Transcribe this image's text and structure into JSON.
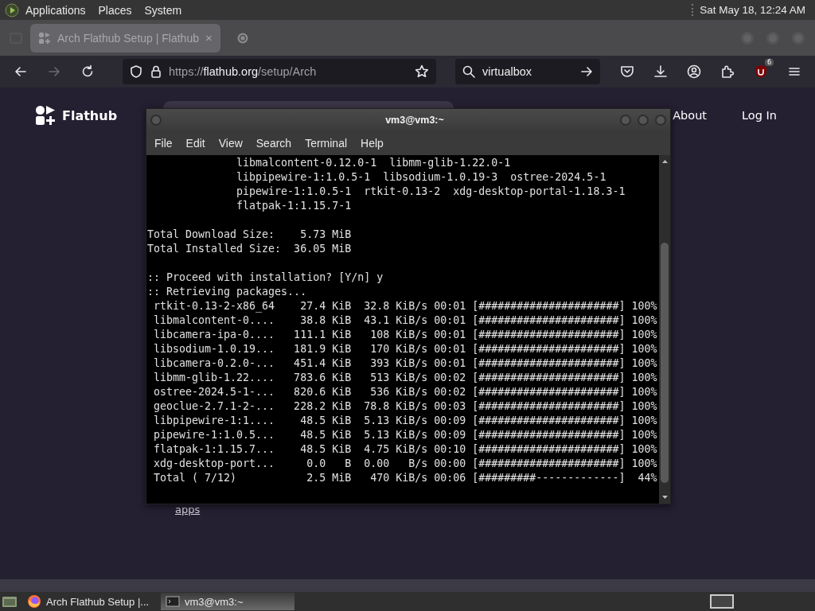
{
  "top_panel": {
    "menus": [
      "Applications",
      "Places",
      "System"
    ],
    "clock": "Sat May 18, 12:24 AM"
  },
  "browser": {
    "tabs": [
      {
        "label": "Arch Flathub Setup | Flathub",
        "selected": true,
        "close": "×"
      },
      {
        "selected": false
      }
    ],
    "back_enabled": true,
    "forward_enabled": false,
    "url": {
      "prefix": "https://",
      "host": "flathub.org",
      "path": "/setup/Arch"
    },
    "search": {
      "value": "virtualbox"
    },
    "extension_badge": "6"
  },
  "site": {
    "brand": "Flathub",
    "nav": [
      "About",
      "Log In"
    ],
    "link_below": "apps"
  },
  "terminal": {
    "title": "vm3@vm3:~",
    "menu": [
      "File",
      "Edit",
      "View",
      "Search",
      "Terminal",
      "Help"
    ],
    "blocks": [
      [
        "              libmalcontent-0.12.0-1  libmm-glib-1.22.0-1",
        "              libpipewire-1:1.0.5-1  libsodium-1.0.19-3  ostree-2024.5-1",
        "              pipewire-1:1.0.5-1  rtkit-0.13-2  xdg-desktop-portal-1.18.3-1",
        "              flatpak-1:1.15.7-1"
      ],
      [
        "Total Download Size:    5.73 MiB",
        "Total Installed Size:  36.05 MiB"
      ],
      [
        ":: Proceed with installation? [Y/n] y",
        ":: Retrieving packages...",
        " rtkit-0.13-2-x86_64    27.4 KiB  32.8 KiB/s 00:01 [######################] 100%",
        " libmalcontent-0....    38.8 KiB  43.1 KiB/s 00:01 [######################] 100%",
        " libcamera-ipa-0....   111.1 KiB   108 KiB/s 00:01 [######################] 100%",
        " libsodium-1.0.19...   181.9 KiB   170 KiB/s 00:01 [######################] 100%",
        " libcamera-0.2.0-...   451.4 KiB   393 KiB/s 00:01 [######################] 100%",
        " libmm-glib-1.22....   783.6 KiB   513 KiB/s 00:02 [######################] 100%",
        " ostree-2024.5-1-...   820.6 KiB   536 KiB/s 00:02 [######################] 100%",
        " geoclue-2.7.1-2-...   228.2 KiB  78.8 KiB/s 00:03 [######################] 100%",
        " libpipewire-1:1....    48.5 KiB  5.13 KiB/s 00:09 [######################] 100%",
        " pipewire-1:1.0.5...    48.5 KiB  5.13 KiB/s 00:09 [######################] 100%",
        " flatpak-1:1.15.7...    48.5 KiB  4.75 KiB/s 00:10 [######################] 100%",
        " xdg-desktop-port...     0.0   B  0.00   B/s 00:00 [######################] 100%",
        " Total ( 7/12)           2.5 MiB   470 KiB/s 00:06 [#########-------------]  44%"
      ]
    ]
  },
  "taskbar": {
    "windows": [
      {
        "label": "Arch Flathub Setup |...",
        "kind": "browser",
        "selected": false
      },
      {
        "label": "vm3@vm3:~",
        "kind": "terminal",
        "selected": true
      }
    ]
  }
}
